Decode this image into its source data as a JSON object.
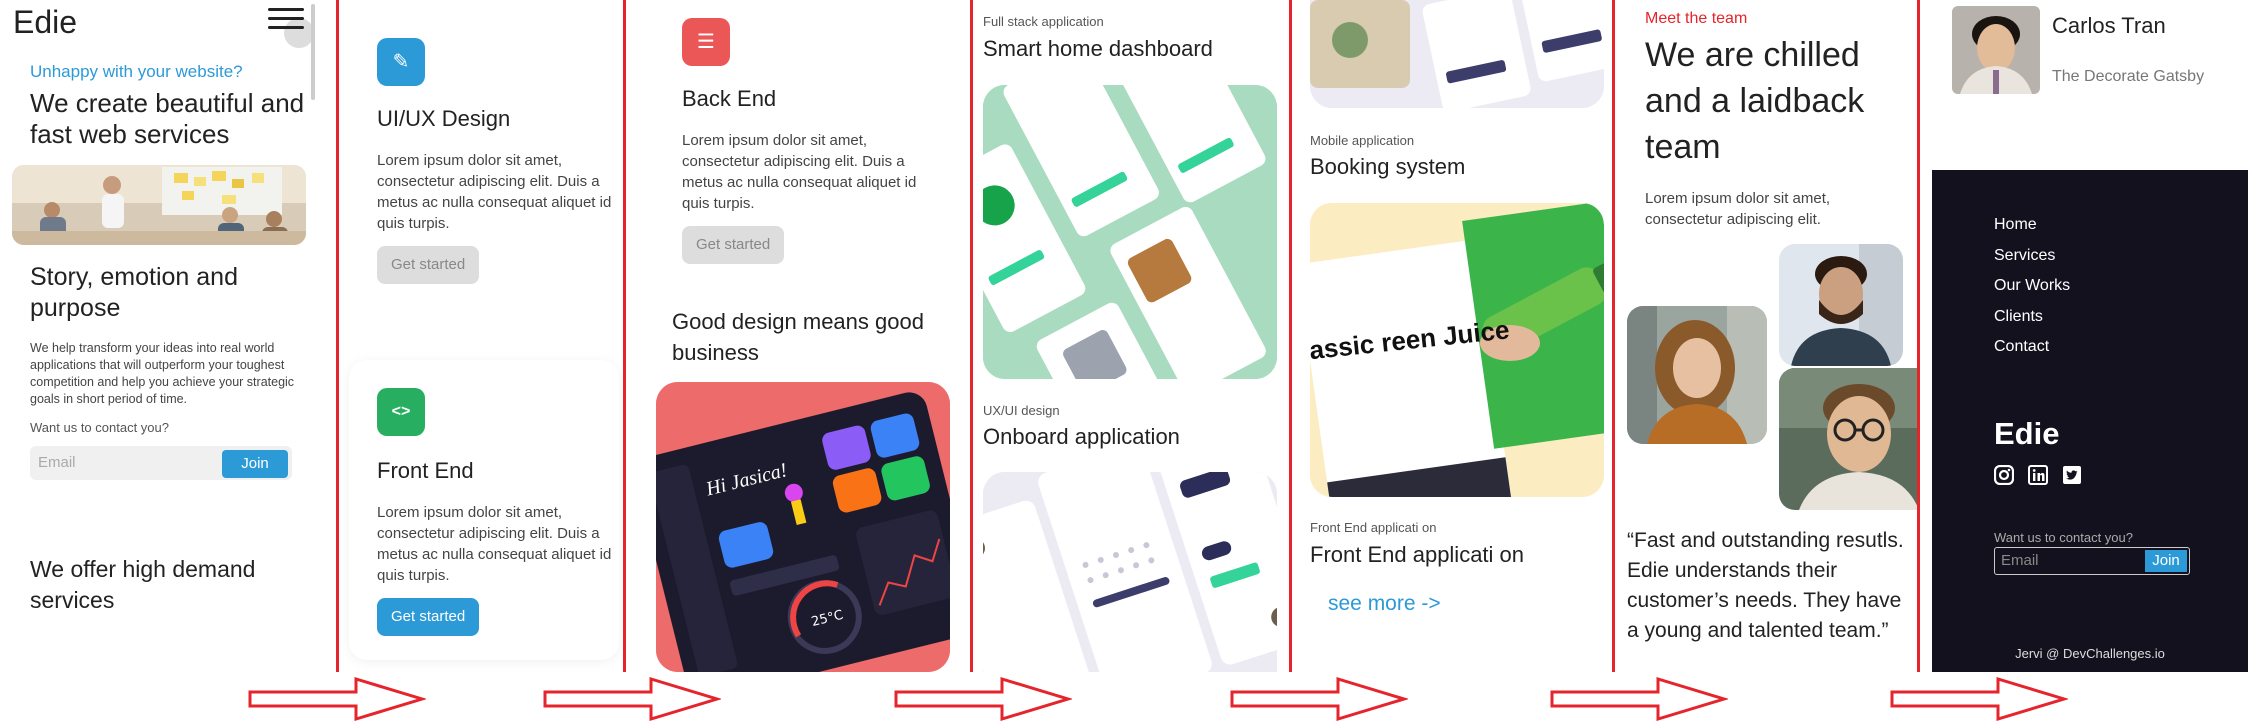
{
  "panel1": {
    "logo": "Edie",
    "hero_kicker": "Unhappy with your website?",
    "hero_title": "We create beautiful and fast web services",
    "story_title": "Story, emotion and purpose",
    "story_body": "We help transform your ideas into real world applications that will outperform your toughest competition and help you achieve your strategic goals in short period of time.",
    "contact_prompt": "Want us to contact you?",
    "email_placeholder": "Email",
    "join_label": "Join",
    "services_title": "We offer high demand services"
  },
  "panel2": {
    "uiux": {
      "title": "UI/UX Design",
      "body": "Lorem ipsum dolor sit amet, consectetur adipiscing elit. Duis a metus ac nulla consequat aliquet id quis turpis.",
      "button": "Get started",
      "icon": "pencil-icon",
      "color": "#2d9ad8"
    },
    "frontend": {
      "title": "Front End",
      "body": "Lorem ipsum dolor sit amet, consectetur adipiscing elit. Duis a metus ac nulla consequat aliquet id quis turpis.",
      "button": "Get started",
      "icon": "code-icon",
      "color": "#27ae60"
    }
  },
  "panel3": {
    "backend": {
      "title": "Back End",
      "body": "Lorem ipsum dolor sit amet, consectetur adipiscing elit. Duis a metus ac nulla consequat aliquet id quis turpis.",
      "button": "Get started",
      "icon": "server-icon",
      "color": "#eb5757"
    },
    "tagline": "Good design means good business",
    "dashboard_greeting": "Hi Jasica!",
    "dashboard_temp": "25°C"
  },
  "panel4": {
    "project1_kind": "Full stack application",
    "project1_title": "Smart home dashboard",
    "project2_kind": "UX/UI design",
    "project2_title": "Onboard application"
  },
  "panel5": {
    "project3_kind": "Mobile application",
    "project3_title": "Booking system",
    "juice_text": "assic reen Juice",
    "project4_kind": "Front End applicati on",
    "project4_title": "Front End applicati on",
    "see_more": "see more ->"
  },
  "panel6": {
    "kicker": "Meet the team",
    "title": "We are chilled and a laidback team",
    "body": "Lorem ipsum dolor sit amet, consectetur adipiscing elit.",
    "quote": "“Fast and outstanding resutls. Edie understands their customer’s needs. They have a young and talented team.”"
  },
  "panel7": {
    "person_name": "Carlos Tran",
    "person_org": "The Decorate Gatsby",
    "nav": [
      "Home",
      "Services",
      "Our Works",
      "Clients",
      "Contact"
    ],
    "footer_logo": "Edie",
    "social": [
      "instagram-icon",
      "linkedin-icon",
      "twitter-icon"
    ],
    "contact_prompt": "Want us to contact you?",
    "email_placeholder": "Email",
    "join_label": "Join",
    "credit": "Jervi @ DevChallenges.io"
  },
  "colors": {
    "accent": "#2d9ad8",
    "divider": "#e5242b",
    "footer_bg": "#14111f"
  }
}
